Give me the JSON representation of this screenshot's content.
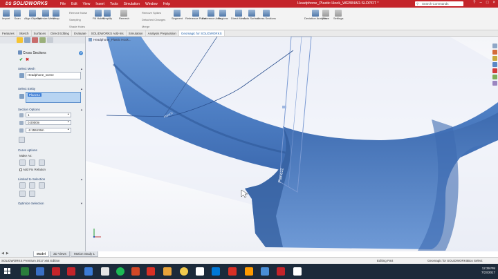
{
  "app": {
    "logo": "SOLIDWORKS",
    "title": "Headphone_Plastic Hook_WEBINAR.SLDPRT *",
    "search_placeholder": "Search Commands",
    "menu": [
      "File",
      "Edit",
      "View",
      "Insert",
      "Tools",
      "Simulation",
      "Window",
      "Help"
    ]
  },
  "ribbon": {
    "commands": [
      {
        "label": "Import",
        "icon": "import-icon"
      },
      {
        "label": "Scan",
        "icon": "scan-icon"
      },
      {
        "label": "Align Objects",
        "icon": "align-icon"
      },
      {
        "label": "Optimize Mesh",
        "icon": "optimize-icon"
      },
      {
        "label": "Wrap",
        "icon": "wrap-icon"
      },
      {
        "label": "Fill Holes",
        "icon": "fill-holes-icon"
      },
      {
        "label": "Simplify",
        "icon": "simplify-icon"
      },
      {
        "label": "Remesh",
        "icon": "remesh-icon"
      },
      {
        "label": "Smooth",
        "icon": "smooth-icon"
      },
      {
        "label": "Regions",
        "icon": "regions-icon"
      },
      {
        "label": "Segment",
        "icon": "segment-icon"
      },
      {
        "label": "Reference Plane",
        "icon": "plane-icon"
      },
      {
        "label": "Reference Axis",
        "icon": "axis-icon"
      },
      {
        "label": "Regions",
        "icon": "regions2-icon"
      },
      {
        "label": "Direct Mesh",
        "icon": "direct-mesh-icon"
      },
      {
        "label": "Auto Surface",
        "icon": "auto-surface-icon"
      },
      {
        "label": "Cross Sections",
        "icon": "cross-sections-icon"
      },
      {
        "label": "Deviation Analysis",
        "icon": "deviation-icon"
      },
      {
        "label": "Show",
        "icon": "show-icon"
      },
      {
        "label": "Settings",
        "icon": "settings-icon"
      }
    ],
    "small_cmds": [
      "Remove Noise",
      "Sampling",
      "Shade Holes",
      "Remove Spikes",
      "Detached Changes",
      "Merge",
      "Smooth",
      "Mesh"
    ]
  },
  "cmd_tabs": [
    "Features",
    "Sketch",
    "Surfaces",
    "Direct Editing",
    "Evaluate",
    "SOLIDWORKS Add-Ins",
    "Simulation",
    "Analysis Preparation",
    "Geomagic for SOLIDWORKS"
  ],
  "cmd_tab_active": "Geomagic for SOLIDWORKS",
  "panel": {
    "title": "Cross Sections",
    "select_mesh": {
      "heading": "Select Mesh",
      "value": "Headphone_scene"
    },
    "select_entity": {
      "heading": "Select Entity",
      "value": "Plane11"
    },
    "section_options": {
      "heading": "Section Options",
      "values": [
        "1",
        "0.0000in",
        "-2.155115m"
      ]
    },
    "curve_options": {
      "heading": "Curve options",
      "make_as": "Make As:",
      "add_fix": "Add Fix Relation"
    },
    "limited": {
      "heading": "Limited to Selection"
    },
    "optimize": {
      "heading": "Optimize Selection"
    }
  },
  "viewport": {
    "tree_label": "Headphone_Plastic Hook...",
    "plane_label": "Plane11",
    "plane_label2": "Plane11"
  },
  "bottom_tabs": [
    "Model",
    "3D Views",
    "Motion Study 1"
  ],
  "status": {
    "left": "SOLIDWORKS Premium 2017 x64 Edition",
    "mid": "Editing Part",
    "addin": "Geomagic for SOLIDWORKS",
    "right": "Box Select"
  },
  "tray": {
    "time": "12:39 PM",
    "date": "7/23/2017"
  },
  "colors": {
    "brand": "#c4242a",
    "mesh": "#4f7ec4",
    "mesh_dark": "#345e9e",
    "plane": "#6f93cf",
    "taskbar": "#1c2a3a"
  }
}
